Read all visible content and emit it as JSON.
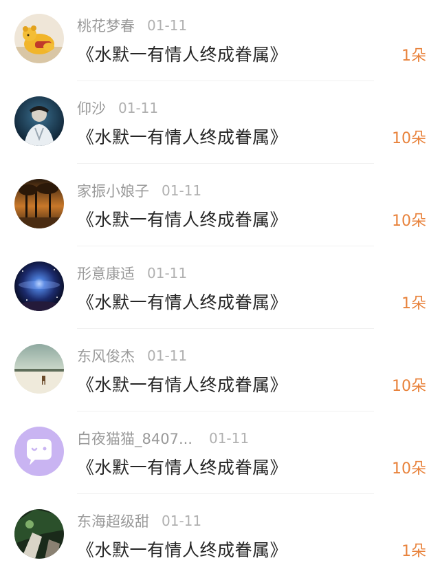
{
  "items": [
    {
      "name": "桃花梦春",
      "date": "01-11",
      "title": "《水默一有情人终成眷属》",
      "count": "1朵",
      "avatar": "pooh-bear-avatar"
    },
    {
      "name": "仰沙",
      "date": "01-11",
      "title": "《水默一有情人终成眷属》",
      "count": "10朵",
      "avatar": "portrait-avatar"
    },
    {
      "name": "家振小娘子",
      "date": "01-11",
      "title": "《水默一有情人终成眷属》",
      "count": "10朵",
      "avatar": "sunset-trees-avatar"
    },
    {
      "name": "形意康适",
      "date": "01-11",
      "title": "《水默一有情人终成眷属》",
      "count": "1朵",
      "avatar": "galaxy-avatar"
    },
    {
      "name": "东风俊杰",
      "date": "01-11",
      "title": "《水默一有情人终成眷属》",
      "count": "10朵",
      "avatar": "snowy-field-avatar"
    },
    {
      "name": "白夜猫猫_8407...",
      "date": "01-11",
      "title": "《水默一有情人终成眷属》",
      "count": "10朵",
      "avatar": "default-chat-avatar"
    },
    {
      "name": "东海超级甜",
      "date": "01-11",
      "title": "《水默一有情人终成眷属》",
      "count": "1朵",
      "avatar": "dark-green-avatar"
    }
  ],
  "colors": {
    "name": "#9a9a9a",
    "date": "#b0b0b0",
    "title": "#262626",
    "count": "#e8823b",
    "divider": "#f0f0f0"
  }
}
